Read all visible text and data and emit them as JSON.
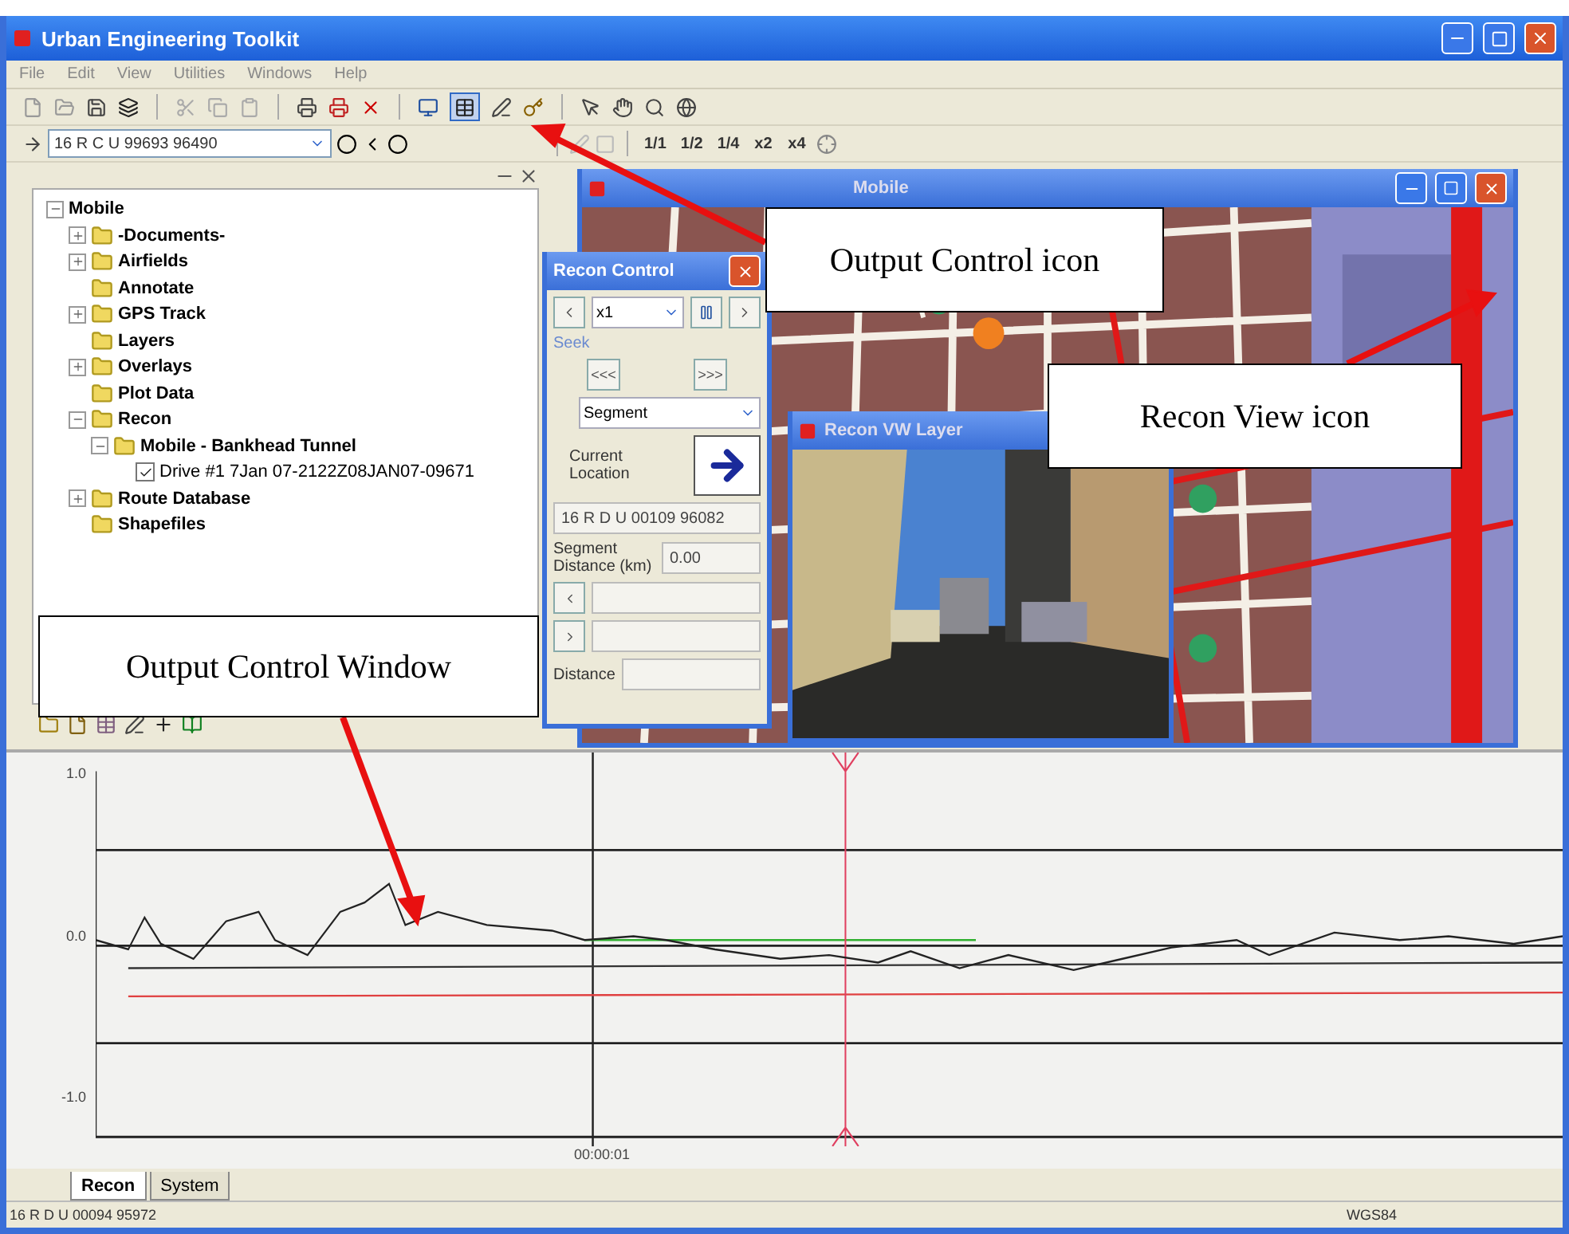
{
  "window": {
    "title": "Urban Engineering Toolkit"
  },
  "menu": [
    "File",
    "Edit",
    "View",
    "Utilities",
    "Windows",
    "Help"
  ],
  "coordinate_field": {
    "value": "16 R C U 99693 96490"
  },
  "rate_buttons": [
    "1/1",
    "1/2",
    "1/4",
    "x2",
    "x4"
  ],
  "tree": [
    {
      "label": "Mobile",
      "expanded": true,
      "children": [
        {
          "label": "-Documents-",
          "expanded": false
        },
        {
          "label": "Airfields",
          "expanded": false
        },
        {
          "label": "Annotate"
        },
        {
          "label": "GPS Track",
          "expanded": false
        },
        {
          "label": "Layers"
        },
        {
          "label": "Overlays",
          "expanded": false
        },
        {
          "label": "Plot Data"
        },
        {
          "label": "Recon",
          "expanded": true,
          "children": [
            {
              "label": "Mobile - Bankhead Tunnel",
              "expanded": true,
              "children": [
                {
                  "label": "Drive #1 7Jan 07-2122Z08JAN07-09671",
                  "checked": true
                }
              ]
            }
          ]
        },
        {
          "label": "Route Database",
          "expanded": false
        },
        {
          "label": "Shapefiles"
        }
      ]
    }
  ],
  "map_window": {
    "title": "Mobile"
  },
  "recon_control": {
    "title": "Recon Control",
    "speed": "x1",
    "seek_label": "Seek",
    "seek_back": "<<<",
    "seek_forward": ">>>",
    "mode": "Segment",
    "location_label": "Current Location",
    "location": "16 R D U 00109 96082",
    "segment_label": "Segment Distance (km)",
    "segment_value": "0.00",
    "distance_label": "Distance"
  },
  "recon_view": {
    "title": "Recon VW Layer"
  },
  "plot": {
    "y_ticks": [
      "1.0",
      "0.0",
      "-1.0"
    ],
    "x_label": "00:00:01"
  },
  "bottom_tabs": [
    {
      "label": "Recon",
      "selected": true
    },
    {
      "label": "System",
      "selected": false
    }
  ],
  "status_bar": {
    "position": "16 R D U 00094 95972",
    "datum": "WGS84"
  },
  "callouts": [
    {
      "text": "Output Control icon"
    },
    {
      "text": "Recon View icon"
    },
    {
      "text": "Output Control Window"
    }
  ]
}
